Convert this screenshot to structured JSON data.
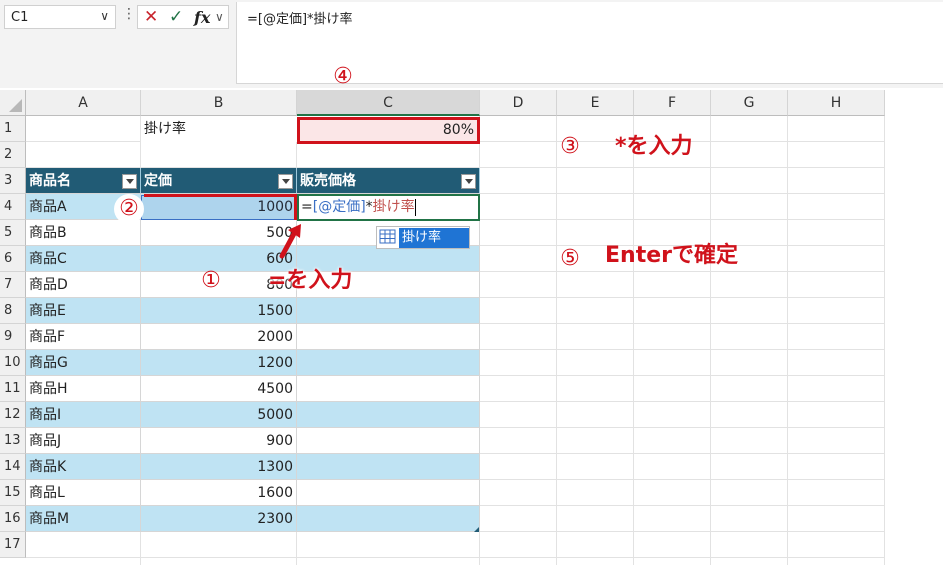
{
  "formula_bar": {
    "name_box": "C1",
    "cancel_icon": "✕",
    "enter_icon": "✓",
    "fx_label": "fx",
    "formula": "=[@定価]*掛け率"
  },
  "columns": [
    "A",
    "B",
    "C",
    "D",
    "E",
    "F",
    "G",
    "H"
  ],
  "rows": [
    "1",
    "2",
    "3",
    "4",
    "5",
    "6",
    "7",
    "8",
    "9",
    "10",
    "11",
    "12",
    "13",
    "14",
    "15",
    "16",
    "17"
  ],
  "sheet": {
    "b1": "掛け率",
    "c1": "80%",
    "table_headers": [
      "商品名",
      "定価",
      "販売価格"
    ],
    "products": [
      {
        "name": "商品A",
        "price": "1000"
      },
      {
        "name": "商品B",
        "price": "500"
      },
      {
        "name": "商品C",
        "price": "600"
      },
      {
        "name": "商品D",
        "price": "800"
      },
      {
        "name": "商品E",
        "price": "1500"
      },
      {
        "name": "商品F",
        "price": "2000"
      },
      {
        "name": "商品G",
        "price": "1200"
      },
      {
        "name": "商品H",
        "price": "4500"
      },
      {
        "name": "商品I",
        "price": "5000"
      },
      {
        "name": "商品J",
        "price": "900"
      },
      {
        "name": "商品K",
        "price": "1300"
      },
      {
        "name": "商品L",
        "price": "1600"
      },
      {
        "name": "商品M",
        "price": "2300"
      }
    ],
    "edit_formula": {
      "eq": "=",
      "ref": "[@定価]",
      "op": "*",
      "name": "掛け率"
    },
    "autocomplete": "掛け率"
  },
  "annotations": {
    "n1": "①",
    "t1": "=を入力",
    "n2": "②",
    "n3": "③",
    "t3": "*を入力",
    "n4": "④",
    "n5": "⑤",
    "t5": "Enterで確定"
  },
  "colors": {
    "accent_red": "#d0121b",
    "table_header": "#215b75",
    "band": "#bfe3f3",
    "excel_green": "#217346"
  }
}
